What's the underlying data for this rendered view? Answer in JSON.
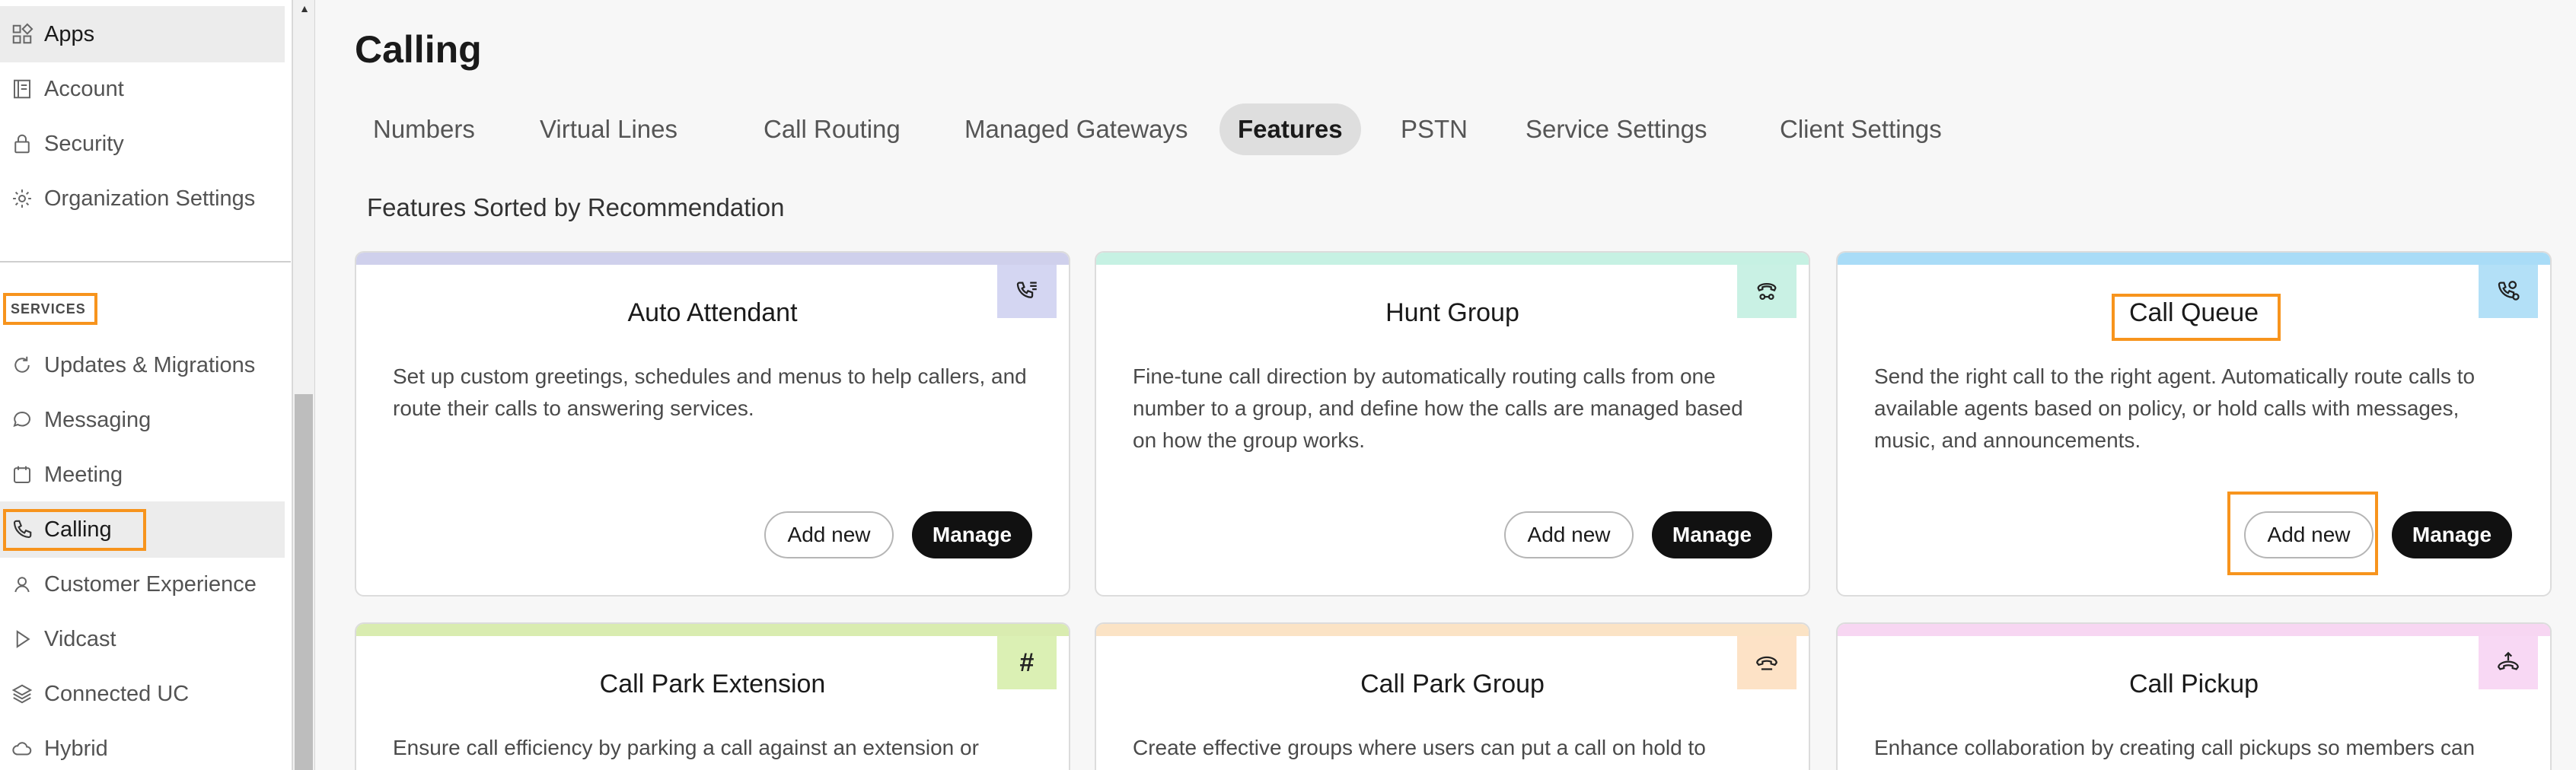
{
  "sidebar": {
    "items_top": [
      {
        "label": "Apps",
        "icon": "apps-icon"
      },
      {
        "label": "Account",
        "icon": "account-icon"
      },
      {
        "label": "Security",
        "icon": "lock-icon"
      },
      {
        "label": "Organization Settings",
        "icon": "gear-icon"
      }
    ],
    "services_header": "SERVICES",
    "items_services": [
      {
        "label": "Updates & Migrations",
        "icon": "refresh-icon"
      },
      {
        "label": "Messaging",
        "icon": "chat-bubble-icon"
      },
      {
        "label": "Meeting",
        "icon": "calendar-icon"
      },
      {
        "label": "Calling",
        "icon": "phone-icon"
      },
      {
        "label": "Customer Experience",
        "icon": "headset-icon"
      },
      {
        "label": "Vidcast",
        "icon": "play-icon"
      },
      {
        "label": "Connected UC",
        "icon": "layers-icon"
      },
      {
        "label": "Hybrid",
        "icon": "cloud-icon"
      }
    ]
  },
  "main": {
    "title": "Calling",
    "tabs": [
      {
        "label": "Numbers"
      },
      {
        "label": "Virtual Lines"
      },
      {
        "label": "Call Routing"
      },
      {
        "label": "Managed Gateways"
      },
      {
        "label": "Features",
        "active": true
      },
      {
        "label": "PSTN"
      },
      {
        "label": "Service Settings"
      },
      {
        "label": "Client Settings"
      }
    ],
    "section_title": "Features Sorted by Recommendation",
    "cards": [
      {
        "title": "Auto Attendant",
        "description": "Set up custom greetings, schedules and menus to help callers, and route their calls to answering services.",
        "accent": "#cfd0ec",
        "badge_bg": "#d4d6f2",
        "icon": "auto-attendant-icon",
        "add_label": "Add new",
        "manage_label": "Manage"
      },
      {
        "title": "Hunt Group",
        "description": "Fine-tune call direction by automatically routing calls from one number to a group, and define how the calls are managed based on how the group works.",
        "accent": "#c6f1e3",
        "badge_bg": "#c9f1e4",
        "icon": "hunt-group-icon",
        "add_label": "Add new",
        "manage_label": "Manage"
      },
      {
        "title": "Call Queue",
        "description": "Send the right call to the right agent. Automatically route calls to available agents based on policy, or hold calls with messages, music, and announcements.",
        "accent": "#a9dcf7",
        "badge_bg": "#b3e0f7",
        "icon": "call-queue-icon",
        "add_label": "Add new",
        "manage_label": "Manage"
      },
      {
        "title": "Call Park Extension",
        "description": "Ensure call efficiency by parking a call against an extension or",
        "accent": "#d9ecb0",
        "badge_bg": "#dbf0b4",
        "icon": "hash-icon",
        "badge_text": "#"
      },
      {
        "title": "Call Park Group",
        "description": "Create effective groups where users can put a call on hold to",
        "accent": "#fbe3c5",
        "badge_bg": "#fde2c6",
        "icon": "call-park-group-icon"
      },
      {
        "title": "Call Pickup",
        "description": "Enhance collaboration by creating call pickups so members can",
        "accent": "#f7d6f2",
        "badge_bg": "#f8d8f4",
        "icon": "call-pickup-icon"
      }
    ]
  },
  "colors": {
    "highlight": "#f7941d",
    "solid_button": "#111111"
  }
}
